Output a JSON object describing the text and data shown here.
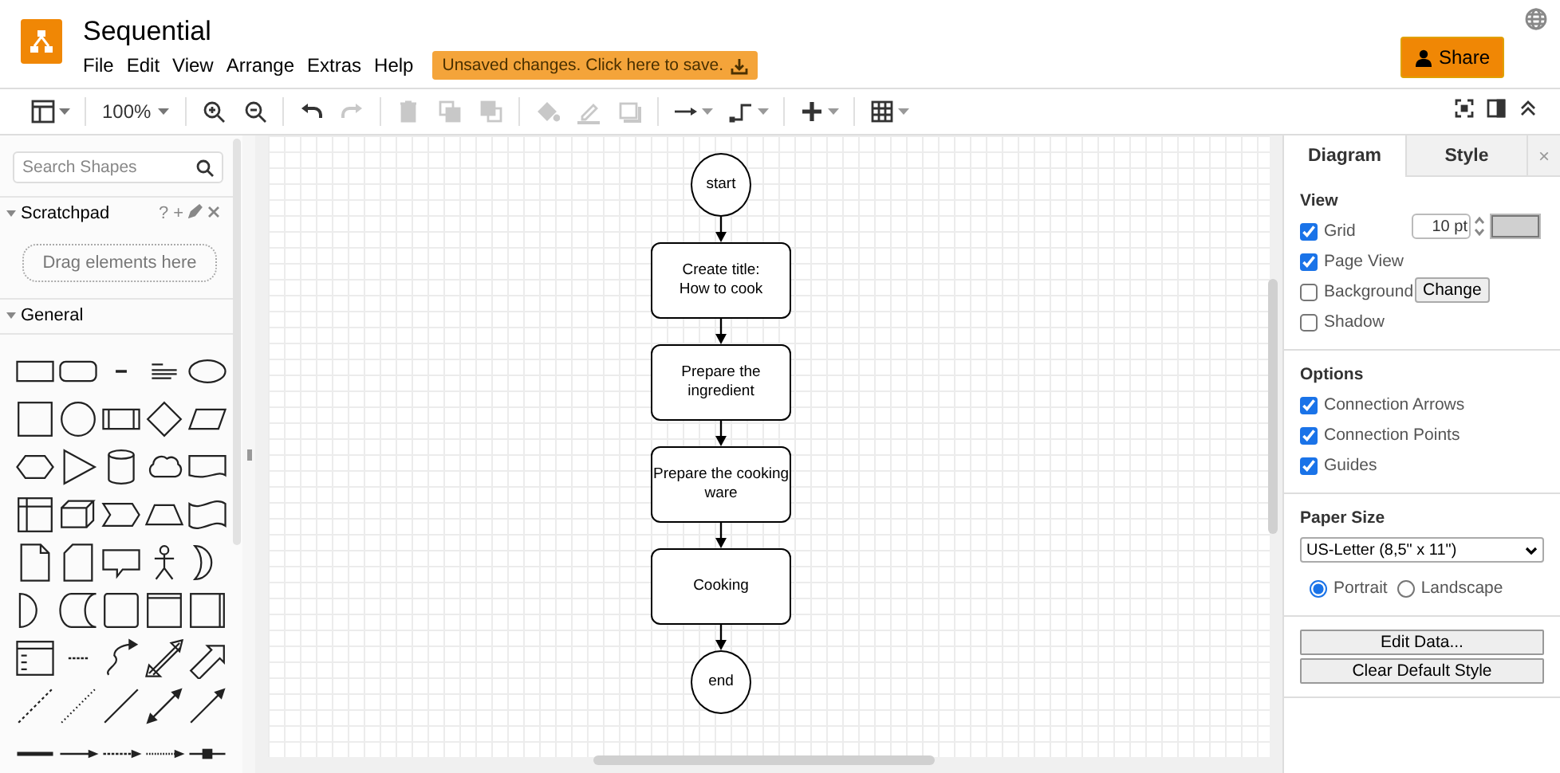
{
  "window": {
    "title": "Sequential"
  },
  "menu": [
    "File",
    "Edit",
    "View",
    "Arrange",
    "Extras",
    "Help"
  ],
  "save_notice": "Unsaved changes. Click here to save.",
  "share_button": "Share",
  "toolbar": {
    "zoom": "100%",
    "tools": [
      {
        "kind": "zoom-in",
        "disabled": false
      },
      {
        "kind": "zoom-out",
        "disabled": false
      },
      {
        "kind": "undo",
        "disabled": false
      },
      {
        "kind": "redo",
        "disabled": true
      },
      {
        "kind": "delete",
        "disabled": true
      },
      {
        "kind": "to-front",
        "disabled": true
      },
      {
        "kind": "to-back",
        "disabled": true
      },
      {
        "kind": "fill",
        "disabled": true
      },
      {
        "kind": "line",
        "disabled": true
      },
      {
        "kind": "shadow",
        "disabled": true
      },
      {
        "kind": "connection",
        "disabled": false
      },
      {
        "kind": "waypoints",
        "disabled": false
      },
      {
        "kind": "insert",
        "disabled": false
      },
      {
        "kind": "table",
        "disabled": false
      }
    ]
  },
  "sidebar": {
    "search": {
      "placeholder": "Search Shapes"
    },
    "scratchpad": {
      "title": "Scratchpad",
      "help": "?",
      "add": "+",
      "hint": "Drag elements here"
    },
    "general": {
      "title": "General"
    }
  },
  "diagram": {
    "nodes": [
      {
        "kind": "ellipse",
        "label": "start"
      },
      {
        "kind": "rounded-rect",
        "label": "Create title:\nHow to cook"
      },
      {
        "kind": "rounded-rect",
        "label": "Prepare the\ningredient"
      },
      {
        "kind": "rounded-rect",
        "label": "Prepare the cooking\nware"
      },
      {
        "kind": "rounded-rect",
        "label": "Cooking"
      },
      {
        "kind": "ellipse",
        "label": "end"
      }
    ]
  },
  "format_panel": {
    "tabs": [
      {
        "label": "Diagram",
        "selected": true
      },
      {
        "label": "Style",
        "selected": false
      }
    ],
    "close": "×",
    "view": {
      "title": "View",
      "items": [
        {
          "label": "Grid",
          "checked": true
        },
        {
          "label": "Page View",
          "checked": true
        },
        {
          "label": "Background",
          "checked": false
        },
        {
          "label": "Shadow",
          "checked": false
        }
      ],
      "grid_size": "10 pt",
      "change_button": "Change"
    },
    "options": {
      "title": "Options",
      "items": [
        {
          "label": "Connection Arrows",
          "checked": true
        },
        {
          "label": "Connection Points",
          "checked": true
        },
        {
          "label": "Guides",
          "checked": true
        }
      ]
    },
    "paper_size": {
      "title": "Paper Size",
      "value": "US-Letter (8,5\" x 11\")",
      "orientations": [
        {
          "label": "Portrait",
          "selected": true
        },
        {
          "label": "Landscape",
          "selected": false
        }
      ]
    },
    "buttons": [
      "Edit Data...",
      "Clear Default Style"
    ]
  }
}
